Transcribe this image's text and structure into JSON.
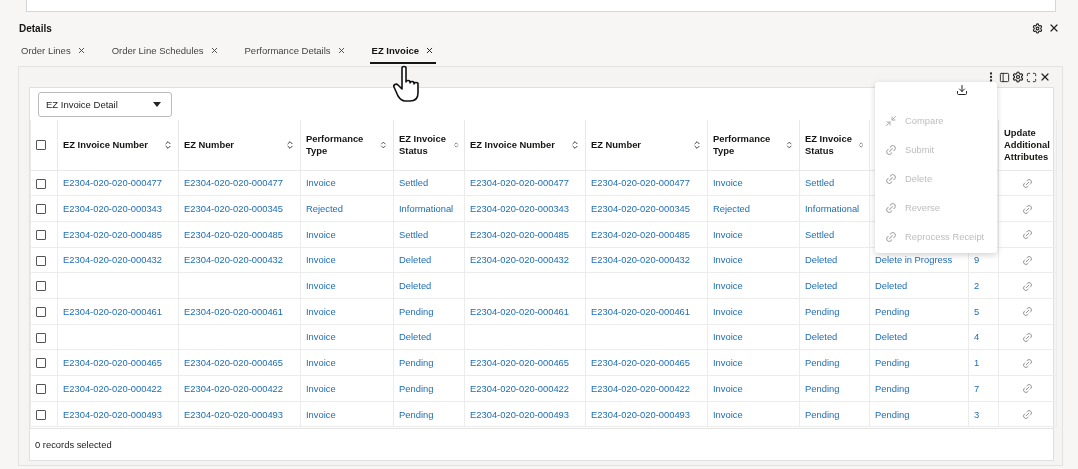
{
  "section": {
    "title": "Details"
  },
  "tabs": [
    {
      "label": "Order Lines",
      "selected": false
    },
    {
      "label": "Order Line Schedules",
      "selected": false
    },
    {
      "label": "Performance Details",
      "selected": false
    },
    {
      "label": "EZ Invoice",
      "selected": true
    }
  ],
  "panel": {
    "view_select": {
      "value": "EZ Invoice Detail"
    },
    "table": {
      "select_all": {
        "checked": false
      },
      "columns": [
        {
          "label": "EZ Invoice Number",
          "sortable": true
        },
        {
          "label": "EZ Number",
          "sortable": true
        },
        {
          "label": "Performance Type",
          "sortable": true
        },
        {
          "label": "EZ Invoice Status",
          "sortable": true
        },
        {
          "label": "EZ Invoice Number",
          "sortable": true
        },
        {
          "label": "EZ Number",
          "sortable": true
        },
        {
          "label": "Performance Type",
          "sortable": true
        },
        {
          "label": "EZ Invoice Status",
          "sortable": true
        },
        null,
        null,
        {
          "label": "Update Additional Attributes"
        }
      ],
      "rows": [
        {
          "checked": false,
          "cells": [
            "E2304-020-020-000477",
            "E2304-020-020-000477",
            "Invoice",
            "Settled",
            "E2304-020-020-000477",
            "E2304-020-020-000477",
            "Invoice",
            "Settled",
            null,
            null
          ]
        },
        {
          "checked": false,
          "cells": [
            "E2304-020-020-000343",
            "E2304-020-020-000345",
            "Rejected",
            "Informational",
            "E2304-020-020-000343",
            "E2304-020-020-000345",
            "Rejected",
            "Informational",
            null,
            null
          ]
        },
        {
          "checked": false,
          "cells": [
            "E2304-020-020-000485",
            "E2304-020-020-000485",
            "Invoice",
            "Settled",
            "E2304-020-020-000485",
            "E2304-020-020-000485",
            "Invoice",
            "Settled",
            null,
            null
          ]
        },
        {
          "checked": false,
          "cells": [
            "E2304-020-020-000432",
            "E2304-020-020-000432",
            "Invoice",
            "Deleted",
            "E2304-020-020-000432",
            "E2304-020-020-000432",
            "Invoice",
            "Deleted",
            "Delete in Progress",
            "9"
          ]
        },
        {
          "checked": false,
          "cells": [
            null,
            null,
            "Invoice",
            "Deleted",
            null,
            null,
            "Invoice",
            "Deleted",
            "Deleted",
            "2"
          ]
        },
        {
          "checked": false,
          "cells": [
            "E2304-020-020-000461",
            "E2304-020-020-000461",
            "Invoice",
            "Pending",
            "E2304-020-020-000461",
            "E2304-020-020-000461",
            "Invoice",
            "Pending",
            "Pending",
            "5"
          ]
        },
        {
          "checked": false,
          "cells": [
            null,
            null,
            "Invoice",
            "Deleted",
            null,
            null,
            "Invoice",
            "Deleted",
            "Deleted",
            "4"
          ]
        },
        {
          "checked": false,
          "cells": [
            "E2304-020-020-000465",
            "E2304-020-020-000465",
            "Invoice",
            "Pending",
            "E2304-020-020-000465",
            "E2304-020-020-000465",
            "Invoice",
            "Pending",
            "Pending",
            "1"
          ]
        },
        {
          "checked": false,
          "cells": [
            "E2304-020-020-000422",
            "E2304-020-020-000422",
            "Invoice",
            "Pending",
            "E2304-020-020-000422",
            "E2304-020-020-000422",
            "Invoice",
            "Pending",
            "Pending",
            "7"
          ]
        },
        {
          "checked": false,
          "cells": [
            "E2304-020-020-000493",
            "E2304-020-020-000493",
            "Invoice",
            "Pending",
            "E2304-020-020-000493",
            "E2304-020-020-000493",
            "Invoice",
            "Pending",
            "Pending",
            "3"
          ]
        }
      ]
    },
    "footer": "0 records selected"
  },
  "menu": {
    "items": [
      {
        "label": "Compare",
        "kind": "compare",
        "disabled": true
      },
      {
        "label": "Submit",
        "kind": "link",
        "disabled": true
      },
      {
        "label": "Delete",
        "kind": "link",
        "disabled": true
      },
      {
        "label": "Reverse",
        "kind": "link",
        "disabled": true
      },
      {
        "label": "Reprocess Receipt",
        "kind": "link",
        "disabled": true
      }
    ]
  }
}
